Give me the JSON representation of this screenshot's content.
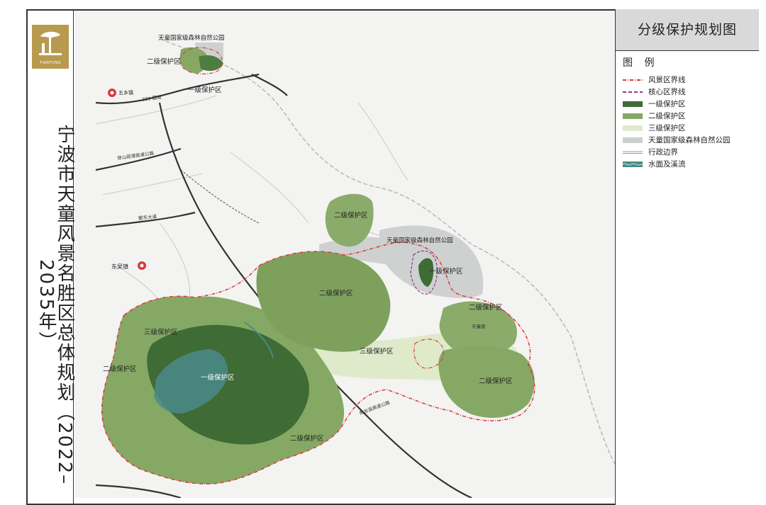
{
  "title_vertical": "宁波市天童风景名胜区总体规划（2022–2035年）",
  "logo_text": "TIANTONG",
  "panel_title": "分级保护规划图",
  "legend_heading": "图 例",
  "legend": [
    {
      "label": "风景区界线",
      "color": "#d63a3a",
      "style": "dash-dot"
    },
    {
      "label": "核心区界线",
      "color": "#8a3a8a",
      "style": "dash"
    },
    {
      "label": "一级保护区",
      "color": "#3f6b35",
      "style": "fill"
    },
    {
      "label": "二级保护区",
      "color": "#86a865",
      "style": "fill"
    },
    {
      "label": "三级保护区",
      "color": "#dfeacb",
      "style": "fill"
    },
    {
      "label": "天童国家级森林自然公园",
      "color": "#cdcfcf",
      "style": "fill"
    },
    {
      "label": "行政边界",
      "color": "#9a9a9a",
      "style": "line"
    },
    {
      "label": "水面及溪流",
      "color": "#4a8a88",
      "style": "water"
    }
  ],
  "map_labels": {
    "park_top": "天童国家级森林自然公园",
    "second_top": "二级保护区",
    "first_top": "一级保护区",
    "town_wuxiang": "五乡镇",
    "second_north": "二级保护区",
    "park_mid": "天童国家级森林自然公园",
    "first_east": "一级保护区",
    "second_center": "二级保护区",
    "second_east_top": "二级保护区",
    "town_dongwu": "东吴镇",
    "third_west": "三级保护区",
    "third_center": "三级保护区",
    "second_west": "二级保护区",
    "first_main": "一级保护区",
    "second_east": "二级保护区",
    "second_south": "二级保护区"
  },
  "road_labels": {
    "r1": "329 国道",
    "r2": "穿山疏港高速公路",
    "r3": "甬台温高速公路",
    "r4": "鄞东大道",
    "r5": "天童路"
  }
}
